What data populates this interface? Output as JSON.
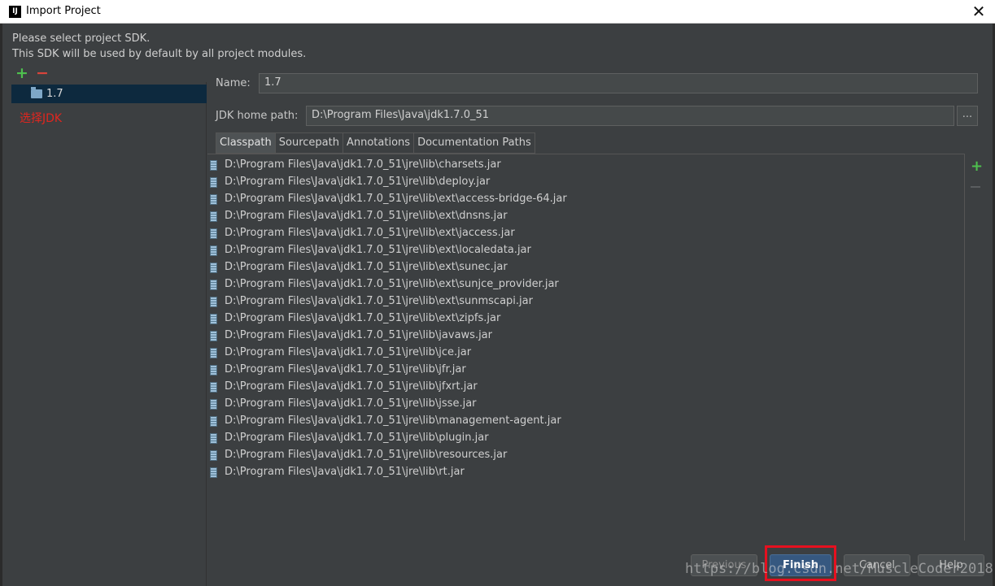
{
  "window": {
    "title": "Import Project",
    "app_icon": "IJ",
    "close_icon": "close-icon"
  },
  "description": {
    "line1": "Please select project SDK.",
    "line2": "This SDK will be used by default by all project modules."
  },
  "sdk_toolbar": {
    "add_icon": "plus-icon",
    "remove_icon": "minus-icon"
  },
  "sdk_list": {
    "items": [
      {
        "label": "1.7",
        "icon": "folder-icon"
      }
    ],
    "annotation": "选择JDK"
  },
  "form": {
    "name_label": "Name:",
    "name_value": "1.7",
    "jdk_label": "JDK home path:",
    "jdk_value": "D:\\Program Files\\Java\\jdk1.7.0_51",
    "browse_label": "..."
  },
  "tabs": [
    "Classpath",
    "Sourcepath",
    "Annotations",
    "Documentation Paths"
  ],
  "paths": [
    "D:\\Program Files\\Java\\jdk1.7.0_51\\jre\\lib\\charsets.jar",
    "D:\\Program Files\\Java\\jdk1.7.0_51\\jre\\lib\\deploy.jar",
    "D:\\Program Files\\Java\\jdk1.7.0_51\\jre\\lib\\ext\\access-bridge-64.jar",
    "D:\\Program Files\\Java\\jdk1.7.0_51\\jre\\lib\\ext\\dnsns.jar",
    "D:\\Program Files\\Java\\jdk1.7.0_51\\jre\\lib\\ext\\jaccess.jar",
    "D:\\Program Files\\Java\\jdk1.7.0_51\\jre\\lib\\ext\\localedata.jar",
    "D:\\Program Files\\Java\\jdk1.7.0_51\\jre\\lib\\ext\\sunec.jar",
    "D:\\Program Files\\Java\\jdk1.7.0_51\\jre\\lib\\ext\\sunjce_provider.jar",
    "D:\\Program Files\\Java\\jdk1.7.0_51\\jre\\lib\\ext\\sunmscapi.jar",
    "D:\\Program Files\\Java\\jdk1.7.0_51\\jre\\lib\\ext\\zipfs.jar",
    "D:\\Program Files\\Java\\jdk1.7.0_51\\jre\\lib\\javaws.jar",
    "D:\\Program Files\\Java\\jdk1.7.0_51\\jre\\lib\\jce.jar",
    "D:\\Program Files\\Java\\jdk1.7.0_51\\jre\\lib\\jfr.jar",
    "D:\\Program Files\\Java\\jdk1.7.0_51\\jre\\lib\\jfxrt.jar",
    "D:\\Program Files\\Java\\jdk1.7.0_51\\jre\\lib\\jsse.jar",
    "D:\\Program Files\\Java\\jdk1.7.0_51\\jre\\lib\\management-agent.jar",
    "D:\\Program Files\\Java\\jdk1.7.0_51\\jre\\lib\\plugin.jar",
    "D:\\Program Files\\Java\\jdk1.7.0_51\\jre\\lib\\resources.jar",
    "D:\\Program Files\\Java\\jdk1.7.0_51\\jre\\lib\\rt.jar"
  ],
  "path_toolbar": {
    "add_icon": "plus-icon",
    "remove_icon": "minus-icon"
  },
  "buttons": {
    "previous": "Previous",
    "finish": "Finish",
    "cancel": "Cancel",
    "help": "Help"
  },
  "watermark": "https://blog.csdn.net/MuscleCoder2018",
  "colors": {
    "accent": "#365880",
    "add": "#4ec04e",
    "remove": "#d9443b",
    "highlight": "#e6101f",
    "background": "#3c3f41"
  }
}
